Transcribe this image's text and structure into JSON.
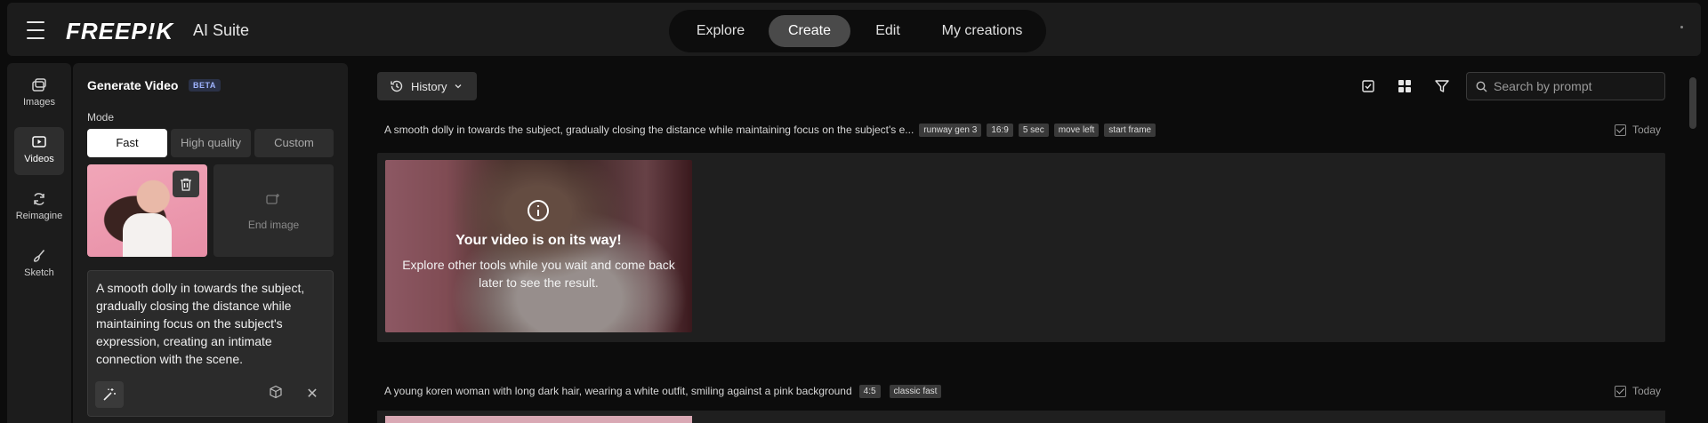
{
  "header": {
    "logo": "FREEP!K",
    "suite": "AI Suite",
    "tabs": [
      {
        "label": "Explore"
      },
      {
        "label": "Create"
      },
      {
        "label": "Edit"
      },
      {
        "label": "My creations"
      }
    ],
    "active_tab": "Create"
  },
  "rail": {
    "items": [
      {
        "label": "Images",
        "icon": "images-icon"
      },
      {
        "label": "Videos",
        "icon": "videos-icon"
      },
      {
        "label": "Reimagine",
        "icon": "reimagine-icon"
      },
      {
        "label": "Sketch",
        "icon": "sketch-icon"
      }
    ],
    "active": "Videos"
  },
  "panel": {
    "title": "Generate Video",
    "badge": "BETA",
    "mode_label": "Mode",
    "modes": [
      "Fast",
      "High quality",
      "Custom"
    ],
    "active_mode": "Fast",
    "end_image_label": "End image",
    "prompt": "A smooth dolly in towards the subject, gradually closing the distance while maintaining focus on the subject's expression, creating an intimate connection with the scene."
  },
  "main": {
    "history_label": "History",
    "search_placeholder": "Search by prompt",
    "items": [
      {
        "prompt": "A smooth dolly in towards the subject, gradually closing the distance while maintaining focus on the subject's e...",
        "tags": [
          "runway gen 3",
          "16:9",
          "5 sec",
          "move left",
          "start frame"
        ],
        "date": "Today",
        "status_title": "Your video is on its way!",
        "status_text": "Explore other tools while you wait and come back later to see the result."
      },
      {
        "prompt": "A young koren woman with long dark hair, wearing a white outfit, smiling against a pink background",
        "tags": [
          "4:5",
          "classic fast"
        ],
        "date": "Today"
      }
    ]
  },
  "colors": {
    "background": "#0c0c0c",
    "panel": "#1c1c1c",
    "active_tab": "#4a4a4a",
    "beta_badge": "#9fb4ff"
  }
}
